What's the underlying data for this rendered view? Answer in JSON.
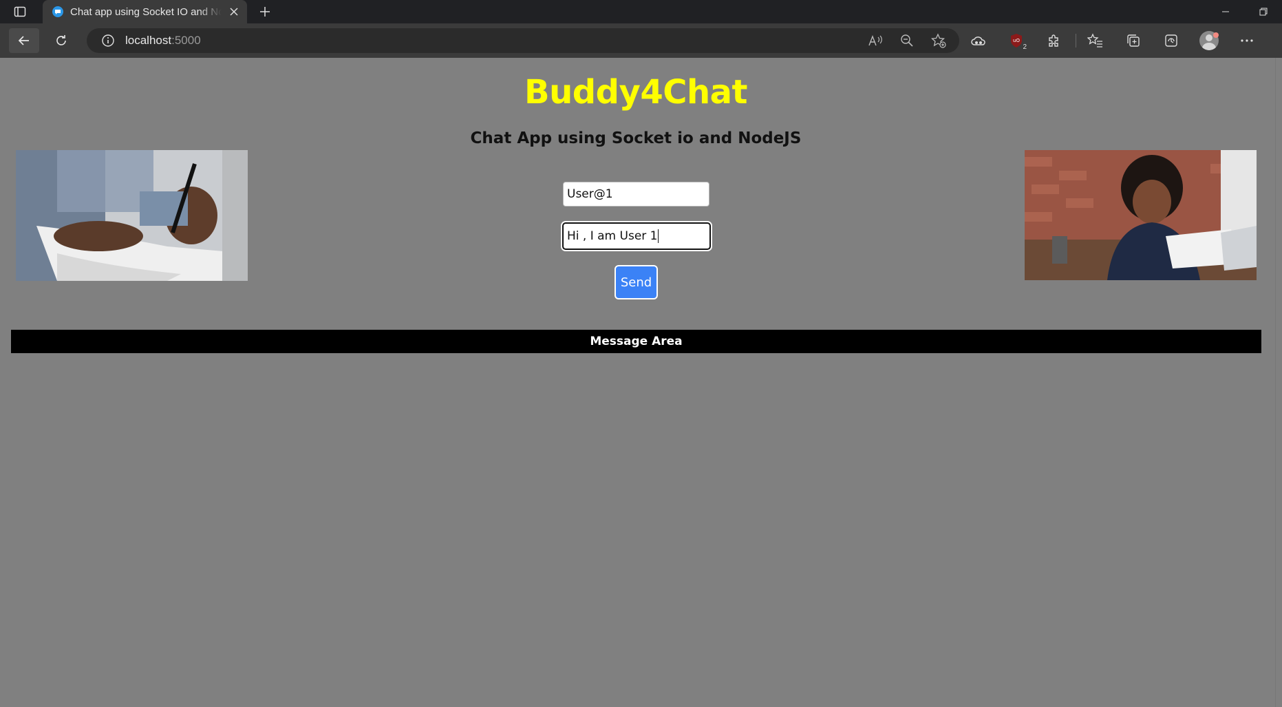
{
  "browser": {
    "tab_title": "Chat app using Socket IO and No",
    "url_host": "localhost",
    "url_port": ":5000",
    "extension_badge": "2"
  },
  "page": {
    "title": "Buddy4Chat",
    "subtitle": "Chat App using Socket io and NodeJS",
    "username_value": "User@1",
    "message_value": "Hi , I am User 1",
    "send_label": "Send",
    "message_area_label": "Message Area"
  },
  "colors": {
    "title": "#ffff00",
    "background": "#808080",
    "send_button": "#3b82f6",
    "message_bar": "#000000"
  },
  "icons": {
    "tab_actions": "tab-actions-icon",
    "new_tab": "plus-icon",
    "back": "arrow-left-icon",
    "reload": "reload-icon",
    "site_info": "info-icon",
    "read_aloud": "read-aloud-icon",
    "zoom": "zoom-out-icon",
    "favorite": "add-favorite-icon",
    "cloud": "cloud-icon",
    "ublock": "ublock-icon",
    "extensions": "puzzle-icon",
    "favorites": "favorites-icon",
    "collections": "collections-icon",
    "browser_essentials": "browser-essentials-icon",
    "profile": "avatar",
    "more": "more-icon"
  }
}
